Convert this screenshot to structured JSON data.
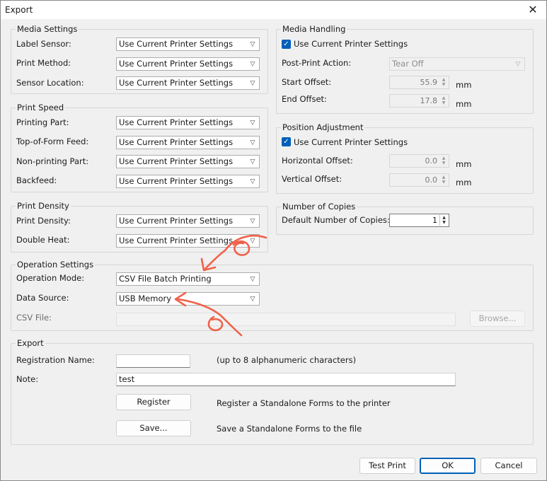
{
  "window": {
    "title": "Export",
    "close_glyph": "✕"
  },
  "media_settings": {
    "title": "Media Settings",
    "label_sensor": {
      "label": "Label Sensor:",
      "value": "Use Current Printer Settings"
    },
    "print_method": {
      "label": "Print Method:",
      "value": "Use Current Printer Settings"
    },
    "sensor_location": {
      "label": "Sensor Location:",
      "value": "Use Current Printer Settings"
    }
  },
  "print_speed": {
    "title": "Print Speed",
    "printing_part": {
      "label": "Printing Part:",
      "value": "Use Current Printer Settings"
    },
    "top_of_form_feed": {
      "label": "Top-of-Form Feed:",
      "value": "Use Current Printer Settings"
    },
    "non_printing_part": {
      "label": "Non-printing Part:",
      "value": "Use Current Printer Settings"
    },
    "backfeed": {
      "label": "Backfeed:",
      "value": "Use Current Printer Settings"
    }
  },
  "print_density": {
    "title": "Print Density",
    "print_density": {
      "label": "Print Density:",
      "value": "Use Current Printer Settings"
    },
    "double_heat": {
      "label": "Double Heat:",
      "value": "Use Current Printer Settings"
    }
  },
  "media_handling": {
    "title": "Media Handling",
    "use_current": {
      "label": "Use Current Printer Settings",
      "checked": true
    },
    "post_print_action": {
      "label": "Post-Print Action:",
      "value": "Tear Off"
    },
    "start_offset": {
      "label": "Start Offset:",
      "value": "55.9",
      "unit": "mm"
    },
    "end_offset": {
      "label": "End Offset:",
      "value": "17.8",
      "unit": "mm"
    }
  },
  "position_adjustment": {
    "title": "Position Adjustment",
    "use_current": {
      "label": "Use Current Printer Settings",
      "checked": true
    },
    "horizontal_offset": {
      "label": "Horizontal Offset:",
      "value": "0.0",
      "unit": "mm"
    },
    "vertical_offset": {
      "label": "Vertical Offset:",
      "value": "0.0",
      "unit": "mm"
    }
  },
  "number_of_copies": {
    "title": "Number of Copies",
    "default_copies": {
      "label": "Default Number of Copies:",
      "value": "1"
    }
  },
  "operation_settings": {
    "title": "Operation Settings",
    "operation_mode": {
      "label": "Operation Mode:",
      "value": "CSV File Batch Printing"
    },
    "data_source": {
      "label": "Data Source:",
      "value": "USB Memory"
    },
    "csv_file": {
      "label": "CSV File:",
      "value": "",
      "browse_label": "Browse..."
    }
  },
  "export": {
    "title": "Export",
    "registration_name": {
      "label": "Registration Name:",
      "value": "",
      "hint": "(up to 8 alphanumeric characters)"
    },
    "note": {
      "label": "Note:",
      "value": "test"
    },
    "register": {
      "label": "Register",
      "description": "Register a Standalone Forms to the printer"
    },
    "save": {
      "label": "Save...",
      "description": "Save a Standalone Forms to the file"
    }
  },
  "footer": {
    "test_print": "Test Print",
    "ok": "OK",
    "cancel": "Cancel"
  },
  "icons": {
    "dropdown": "chevron-down-icon",
    "spinner": "spinner-arrows-icon",
    "checkbox": "checkmark-icon",
    "close": "close-icon",
    "annotation": "red-arrow-annotation"
  },
  "colors": {
    "accent": "#005fb8",
    "annotation": "#f0614a",
    "background": "#f0f0f0"
  }
}
